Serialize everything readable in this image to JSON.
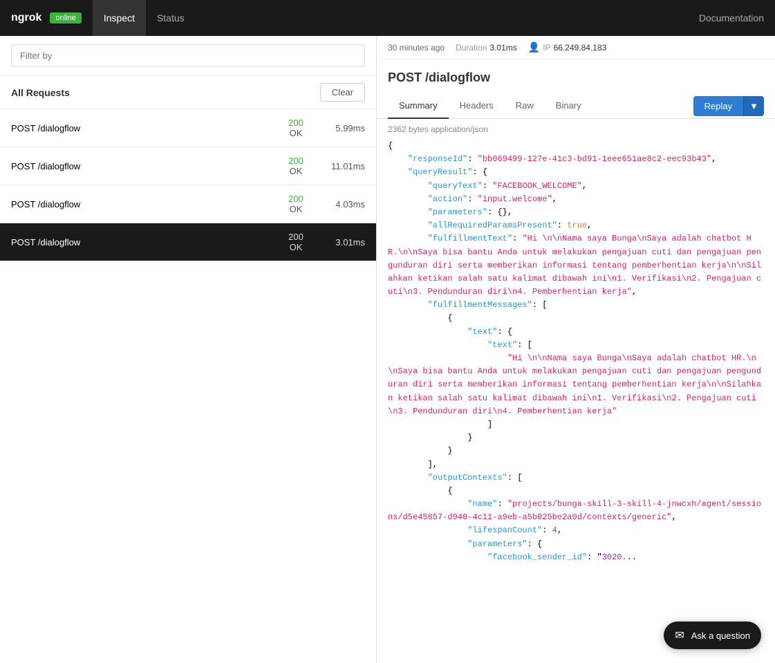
{
  "nav": {
    "brand": "ngrok",
    "badge": "online",
    "items": [
      {
        "label": "Inspect",
        "active": true
      },
      {
        "label": "Status",
        "active": false
      }
    ],
    "docs_label": "Documentation"
  },
  "filter": {
    "placeholder": "Filter by",
    "value": ""
  },
  "requests": {
    "title": "All Requests",
    "clear_label": "Clear",
    "items": [
      {
        "method_path": "POST /dialogflow",
        "status_code": "200",
        "status_text": "OK",
        "duration": "5.99ms",
        "active": false
      },
      {
        "method_path": "POST /dialogflow",
        "status_code": "200",
        "status_text": "OK",
        "duration": "11.01ms",
        "active": false
      },
      {
        "method_path": "POST /dialogflow",
        "status_code": "200",
        "status_text": "OK",
        "duration": "4.03ms",
        "active": false
      },
      {
        "method_path": "POST /dialogflow",
        "status_code": "200",
        "status_text": "OK",
        "duration": "3.01ms",
        "active": true
      }
    ]
  },
  "detail": {
    "meta": {
      "time_ago": "30 minutes ago",
      "duration_label": "Duration",
      "duration_value": "3.01ms",
      "ip_label": "IP",
      "ip_value": "66.249.84.183"
    },
    "title": "POST /dialogflow",
    "tabs": [
      {
        "label": "Summary",
        "active": true
      },
      {
        "label": "Headers",
        "active": false
      },
      {
        "label": "Raw",
        "active": false
      },
      {
        "label": "Binary",
        "active": false
      }
    ],
    "replay_label": "Replay",
    "bytes_info": "2362 bytes application/json",
    "json_content": "{\n    \"responseId\": \"bb069499-127e-41c3-bd91-1eee651ae8c2-eec93b43\",\n    \"queryResult\": {\n        \"queryText\": \"FACEBOOK_WELCOME\",\n        \"action\": \"input.welcome\",\n        \"parameters\": {},\n        \"allRequiredParamsPresent\": true,\n        \"fulfillmentText\": \"Hi \\n\\nNama saya Bunga\\nSaya adalah chatbot HR.\\n\\nSaya bisa bantu Anda untuk melakukan pengajuan cuti dan pengajuan pengunduran diri serta memberikan informasi tentang pemberhentian kerja\\n\\nSilahkan ketikan salah satu kalimat dibawah ini\\n1. Verifikasi\\n2. Pengajuan cuti\\n3. Pendunduran diri\\n4. Pemberhentian kerja\",\n        \"fulfillmentMessages\": [\n            {\n                \"text\": {\n                    \"text\": [\n                        \"Hi \\n\\nNama saya Bunga\\nSaya adalah chatbot HR.\\n\\nSaya bisa bantu Anda untuk melakukan pengajuan cuti dan pengajuan pengunduran diri serta memberikan informasi tentang pemberhentian kerja\\n\\nSilahkan ketikan salah satu kalimat dibawah ini\\n1. Verifikasi\\n2. Pengajuan cuti\\n3. Pendunduran diri\\n4. Pemberhentian kerja\"\n                    ]\n                }\n            }\n        ],\n        \"outputContexts\": [\n            {\n                \"name\": \"projects/bunga-skill-3-skill-4-jnwcxh/agent/sessions/d5e45857-d940-4c11-a9eb-a5b025be2a0d/contexts/generic\",\n                \"lifespanCount\": 4,\n                \"parameters\": {\n                    \"facebook_sender_id\": \"3020..."
  },
  "chat_widget": {
    "label": "Ask a question"
  },
  "colors": {
    "active_bg": "#1a1a1a",
    "status_ok": "#3db33d",
    "replay_blue": "#2d7dd2"
  }
}
